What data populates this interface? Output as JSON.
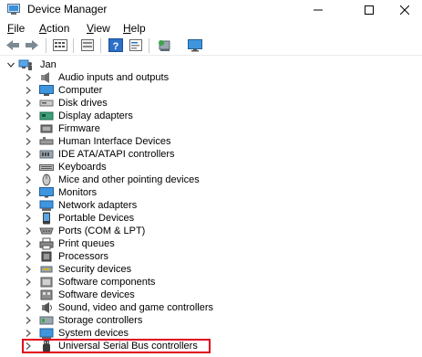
{
  "window": {
    "title": "Device Manager",
    "icon": "device-manager-icon"
  },
  "menu": [
    {
      "label_u": "F",
      "label_rest": "ile"
    },
    {
      "label_u": "A",
      "label_rest": "ction"
    },
    {
      "label_u": "V",
      "label_rest": "iew"
    },
    {
      "label_u": "H",
      "label_rest": "elp"
    }
  ],
  "toolbar": {
    "icons": [
      "back-arrow-icon",
      "forward-arrow-icon",
      "properties-grid-icon",
      "update-driver-icon",
      "help-icon",
      "scan-hardware-icon",
      "monitor-icon"
    ]
  },
  "tree": {
    "root": {
      "label": "Jan",
      "expanded": true
    },
    "items": [
      {
        "label": "Audio inputs and outputs",
        "icon": "speaker-icon"
      },
      {
        "label": "Computer",
        "icon": "computer-icon"
      },
      {
        "label": "Disk drives",
        "icon": "disk-drive-icon"
      },
      {
        "label": "Display adapters",
        "icon": "display-adapter-icon"
      },
      {
        "label": "Firmware",
        "icon": "firmware-icon"
      },
      {
        "label": "Human Interface Devices",
        "icon": "hid-icon"
      },
      {
        "label": "IDE ATA/ATAPI controllers",
        "icon": "ide-controller-icon"
      },
      {
        "label": "Keyboards",
        "icon": "keyboard-icon"
      },
      {
        "label": "Mice and other pointing devices",
        "icon": "mouse-icon"
      },
      {
        "label": "Monitors",
        "icon": "monitor-icon"
      },
      {
        "label": "Network adapters",
        "icon": "network-adapter-icon"
      },
      {
        "label": "Portable Devices",
        "icon": "portable-device-icon"
      },
      {
        "label": "Ports (COM & LPT)",
        "icon": "port-icon"
      },
      {
        "label": "Print queues",
        "icon": "printer-icon"
      },
      {
        "label": "Processors",
        "icon": "processor-icon"
      },
      {
        "label": "Security devices",
        "icon": "security-device-icon"
      },
      {
        "label": "Software components",
        "icon": "software-component-icon"
      },
      {
        "label": "Software devices",
        "icon": "software-device-icon"
      },
      {
        "label": "Sound, video and game controllers",
        "icon": "sound-controller-icon"
      },
      {
        "label": "Storage controllers",
        "icon": "storage-controller-icon"
      },
      {
        "label": "System devices",
        "icon": "system-device-icon"
      },
      {
        "label": "Universal Serial Bus controllers",
        "icon": "usb-icon",
        "highlighted": true
      }
    ]
  },
  "colors": {
    "highlight_border": "#e0001b",
    "icon_blue": "#1e88d6"
  }
}
